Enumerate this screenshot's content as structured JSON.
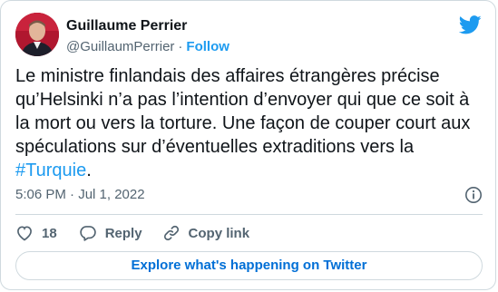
{
  "author": {
    "name": "Guillaume Perrier",
    "handle": "@GuillaumPerrier",
    "separator": "·",
    "follow_label": "Follow"
  },
  "tweet": {
    "text": "Le ministre finlandais des affaires étrangères précise qu’Helsinki n’a pas l’intention d’envoyer qui que ce soit à la mort ou vers la torture. Une façon de couper court aux spéculations sur d’éventuelles extraditions vers la ",
    "hashtag": "#Turquie",
    "text_end": ".",
    "timestamp": "5:06 PM · Jul 1, 2022"
  },
  "actions": {
    "like_count": "18",
    "reply_label": "Reply",
    "copy_link_label": "Copy link"
  },
  "explore_label": "Explore what's happening on Twitter",
  "colors": {
    "accent": "#1d9bf0",
    "link": "#006fd6",
    "muted": "#536471",
    "text": "#0f1419",
    "border": "#cfd9de"
  },
  "icons": [
    "twitter-bird-icon",
    "info-icon",
    "heart-icon",
    "reply-icon",
    "link-icon"
  ]
}
